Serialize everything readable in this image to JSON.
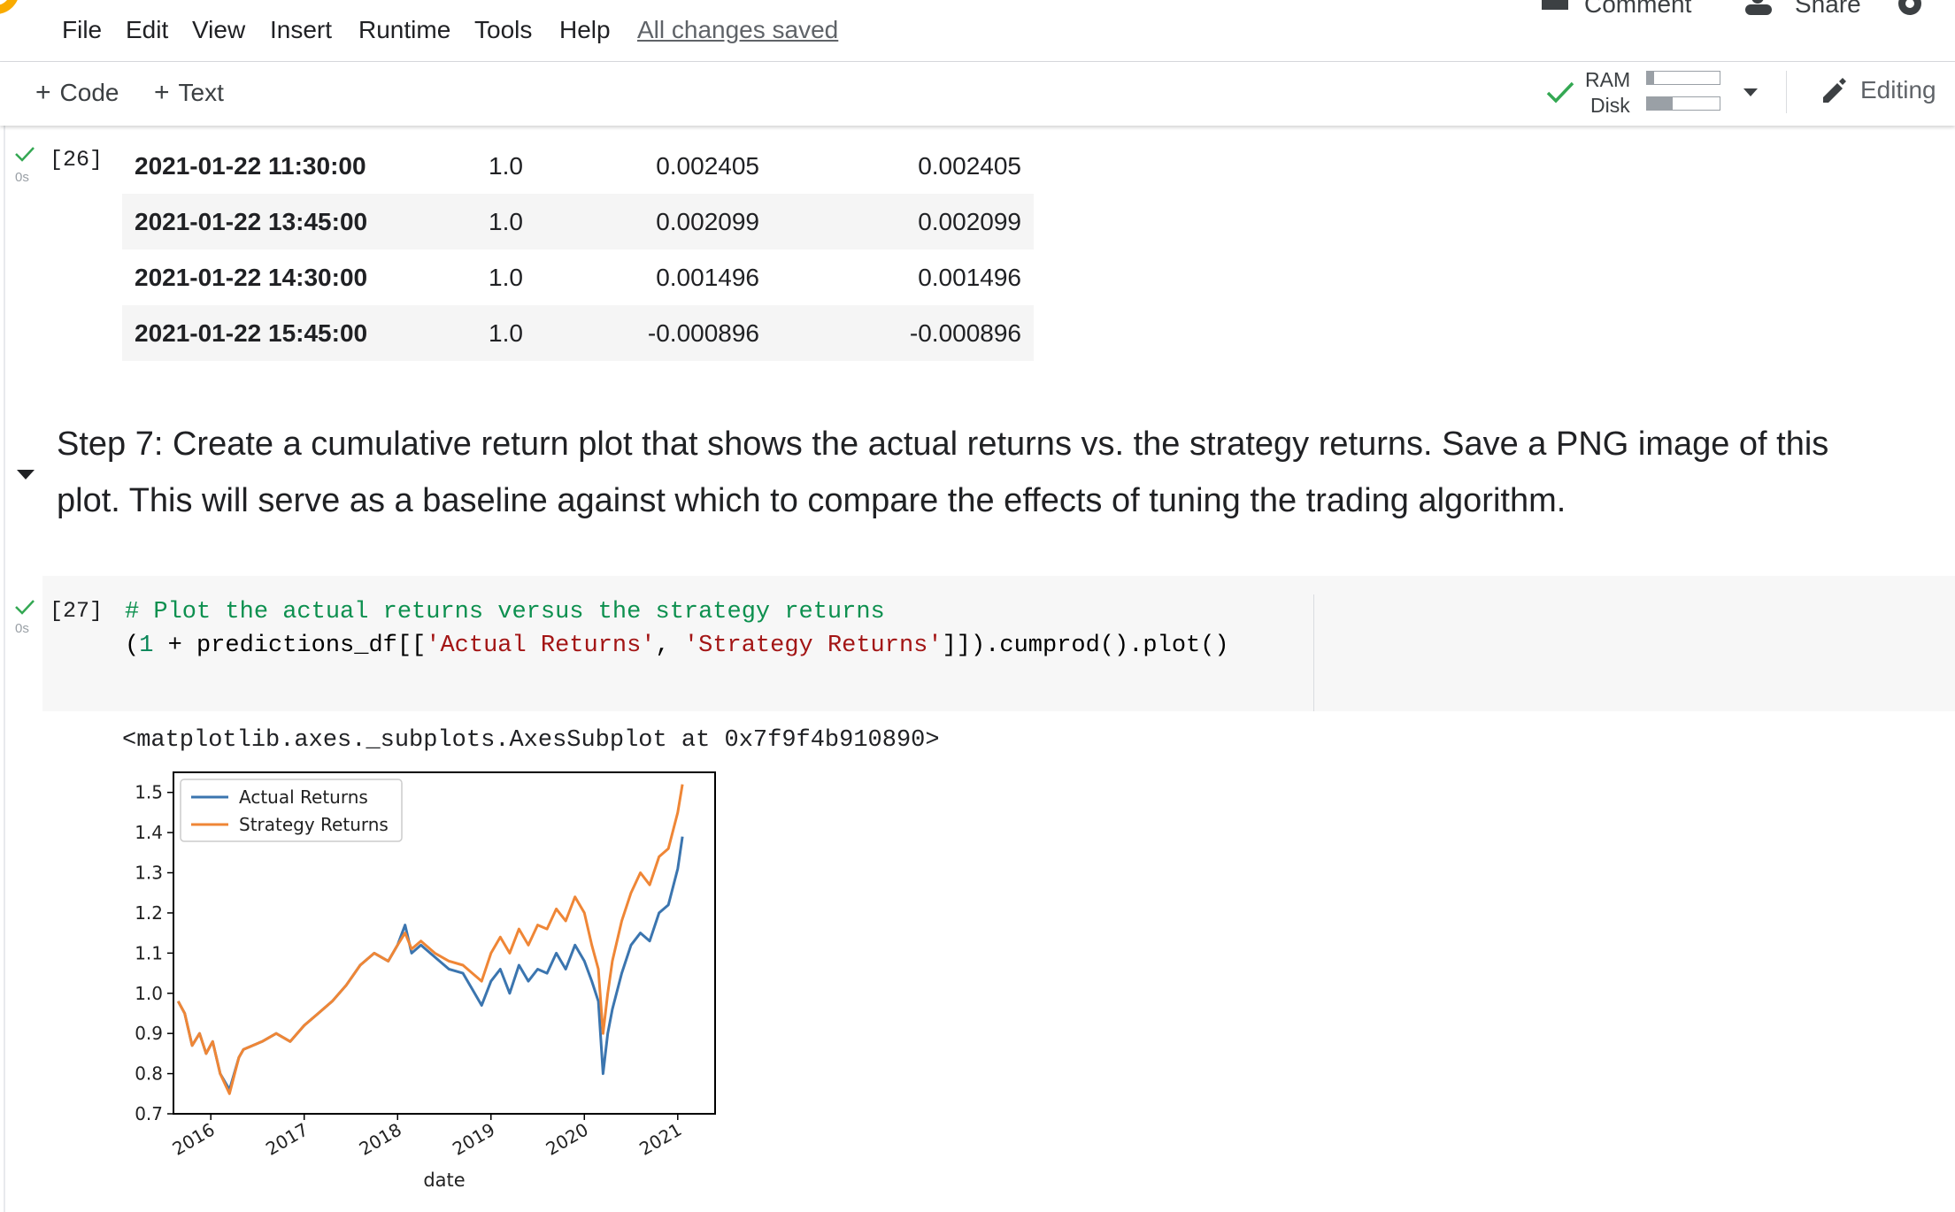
{
  "menu": {
    "items": [
      "File",
      "Edit",
      "View",
      "Insert",
      "Runtime",
      "Tools",
      "Help"
    ],
    "saved_status": "All changes saved"
  },
  "header": {
    "comment_label": "Comment",
    "share_label": "Share"
  },
  "toolbar": {
    "add_code": "Code",
    "add_text": "Text",
    "ram_label": "RAM",
    "disk_label": "Disk",
    "ram_usage": 0.1,
    "disk_usage": 0.35,
    "editing_label": "Editing"
  },
  "cell26": {
    "exec_count": "[26]",
    "exec_time": "0s",
    "rows": [
      [
        "2021-01-22 11:30:00",
        "1.0",
        "0.002405",
        "0.002405"
      ],
      [
        "2021-01-22 13:45:00",
        "1.0",
        "0.002099",
        "0.002099"
      ],
      [
        "2021-01-22 14:30:00",
        "1.0",
        "0.001496",
        "0.001496"
      ],
      [
        "2021-01-22 15:45:00",
        "1.0",
        "-0.000896",
        "-0.000896"
      ]
    ]
  },
  "markdown": {
    "text": "Step 7: Create a cumulative return plot that shows the actual returns vs. the strategy returns. Save a PNG image of this plot. This will serve as a baseline against which to compare the effects of tuning the trading algorithm."
  },
  "cell27": {
    "exec_count": "[27]",
    "exec_time": "0s",
    "code_comment": "# Plot the actual returns versus the strategy returns",
    "code_open": "(",
    "code_one": "1",
    "code_mid": " + predictions_df[[",
    "code_str1": "'Actual Returns'",
    "code_comma": ", ",
    "code_str2": "'Strategy Returns'",
    "code_end": "]]).cumprod().plot()",
    "output": "<matplotlib.axes._subplots.AxesSubplot at 0x7f9f4b910890>"
  },
  "chart_data": {
    "type": "line",
    "xlabel": "date",
    "ylabel": "",
    "xlim": [
      2015.6,
      2021.4
    ],
    "ylim": [
      0.7,
      1.55
    ],
    "x_ticks": [
      "2016",
      "2017",
      "2018",
      "2019",
      "2020",
      "2021"
    ],
    "y_ticks": [
      "0.7",
      "0.8",
      "0.9",
      "1.0",
      "1.1",
      "1.2",
      "1.3",
      "1.4",
      "1.5"
    ],
    "legend_position": "top-left",
    "series": [
      {
        "name": "Actual Returns",
        "color": "#3b75af",
        "x": [
          2015.65,
          2015.72,
          2015.8,
          2015.88,
          2015.95,
          2016.02,
          2016.1,
          2016.2,
          2016.3,
          2016.35,
          2016.45,
          2016.55,
          2016.7,
          2016.85,
          2017.0,
          2017.15,
          2017.3,
          2017.45,
          2017.6,
          2017.75,
          2017.9,
          2018.0,
          2018.08,
          2018.15,
          2018.25,
          2018.4,
          2018.55,
          2018.7,
          2018.8,
          2018.9,
          2019.0,
          2019.1,
          2019.2,
          2019.3,
          2019.4,
          2019.5,
          2019.6,
          2019.7,
          2019.8,
          2019.9,
          2020.0,
          2020.08,
          2020.15,
          2020.2,
          2020.25,
          2020.3,
          2020.4,
          2020.5,
          2020.6,
          2020.7,
          2020.8,
          2020.9,
          2021.0,
          2021.05
        ],
        "y": [
          0.98,
          0.95,
          0.87,
          0.9,
          0.85,
          0.88,
          0.8,
          0.76,
          0.84,
          0.86,
          0.87,
          0.88,
          0.9,
          0.88,
          0.92,
          0.95,
          0.98,
          1.02,
          1.07,
          1.1,
          1.08,
          1.12,
          1.17,
          1.1,
          1.12,
          1.09,
          1.06,
          1.05,
          1.01,
          0.97,
          1.03,
          1.06,
          1.0,
          1.07,
          1.03,
          1.06,
          1.05,
          1.1,
          1.06,
          1.12,
          1.08,
          1.03,
          0.98,
          0.8,
          0.9,
          0.96,
          1.05,
          1.12,
          1.15,
          1.13,
          1.2,
          1.22,
          1.31,
          1.39
        ]
      },
      {
        "name": "Strategy Returns",
        "color": "#ef8636",
        "x": [
          2015.65,
          2015.72,
          2015.8,
          2015.88,
          2015.95,
          2016.02,
          2016.1,
          2016.2,
          2016.3,
          2016.35,
          2016.45,
          2016.55,
          2016.7,
          2016.85,
          2017.0,
          2017.15,
          2017.3,
          2017.45,
          2017.6,
          2017.75,
          2017.9,
          2018.0,
          2018.08,
          2018.15,
          2018.25,
          2018.4,
          2018.55,
          2018.7,
          2018.8,
          2018.9,
          2019.0,
          2019.1,
          2019.2,
          2019.3,
          2019.4,
          2019.5,
          2019.6,
          2019.7,
          2019.8,
          2019.9,
          2020.0,
          2020.08,
          2020.15,
          2020.2,
          2020.25,
          2020.3,
          2020.4,
          2020.5,
          2020.6,
          2020.7,
          2020.8,
          2020.9,
          2021.0,
          2021.05
        ],
        "y": [
          0.98,
          0.95,
          0.87,
          0.9,
          0.85,
          0.88,
          0.8,
          0.75,
          0.84,
          0.86,
          0.87,
          0.88,
          0.9,
          0.88,
          0.92,
          0.95,
          0.98,
          1.02,
          1.07,
          1.1,
          1.08,
          1.12,
          1.15,
          1.11,
          1.13,
          1.1,
          1.08,
          1.07,
          1.05,
          1.03,
          1.1,
          1.14,
          1.1,
          1.16,
          1.12,
          1.17,
          1.16,
          1.21,
          1.18,
          1.24,
          1.2,
          1.12,
          1.06,
          0.9,
          1.0,
          1.08,
          1.18,
          1.25,
          1.3,
          1.27,
          1.34,
          1.36,
          1.45,
          1.52
        ]
      }
    ]
  }
}
